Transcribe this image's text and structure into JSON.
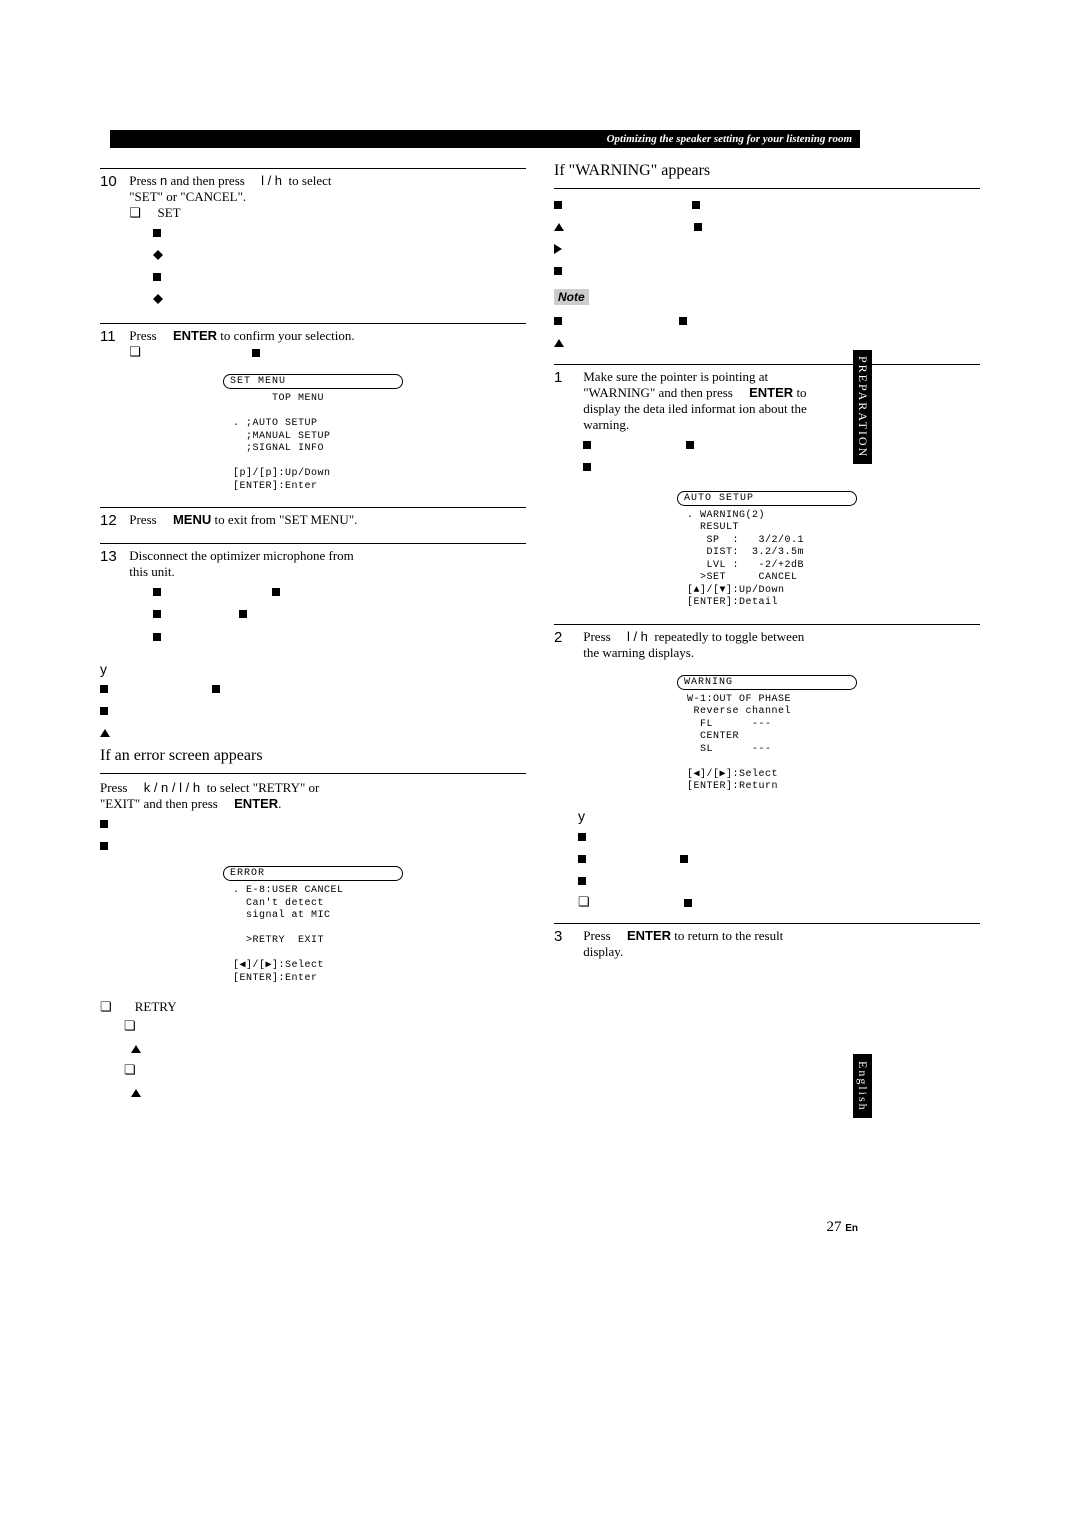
{
  "header": {
    "banner": "Optimizing the speaker setting for your listening room"
  },
  "side_tabs": {
    "prep": "PREPARATION",
    "lang": "English"
  },
  "left": {
    "step10": {
      "num": "10",
      "l1a": "Press",
      "l1b": "n",
      "l1c": "and then press",
      "l1d": "l / h",
      "l1e": "to select",
      "l2": "\"SET\" or \"CANCEL\".",
      "set": "SET"
    },
    "step11": {
      "num": "11",
      "l1a": "Press",
      "l1b": "ENTER",
      "l1c": "to confirm your selection."
    },
    "screen1": {
      "title": "SET MENU",
      "body": "      TOP MENU\n\n. ;AUTO SETUP\n  ;MANUAL SETUP\n  ;SIGNAL INFO\n\n[p]/[p]:Up/Down\n[ENTER]:Enter"
    },
    "step12": {
      "num": "12",
      "l1a": "Press",
      "l1b": "MENU",
      "l1c": "to exit from \"SET MENU\"."
    },
    "step13": {
      "num": "13",
      "l1": "Disconnect the optimizer microphone from",
      "l2": "this unit."
    },
    "y": "y",
    "error_heading": "If an error screen appears",
    "error_l1a": "Press",
    "error_l1b": "k / n / l / h",
    "error_l1c": "to select \"RETRY\" or",
    "error_l2a": "\"EXIT\" and then press",
    "error_l2b": "ENTER",
    "error_l2c": ".",
    "screen2": {
      "title": "ERROR",
      "body": ". E-8:USER CANCEL\n  Can't detect\n  signal at MIC\n\n  >RETRY  EXIT\n\n[◀]/[▶]:Select\n[ENTER]:Enter"
    },
    "retry": "RETRY"
  },
  "right": {
    "warn_heading": "If \"WARNING\" appears",
    "note_label": "Note",
    "step1": {
      "num": "1",
      "l1": "Make sure the pointer is pointing at",
      "l2a": "\"WARNING\" and then press",
      "l2b": "ENTER",
      "l2c": "to",
      "l3": "display the deta     iled informat   ion about the",
      "l4": "warning."
    },
    "screen3": {
      "title": "AUTO SETUP",
      "body": ". WARNING(2)\n  RESULT\n   SP  :   3/2/0.1\n   DIST:  3.2/3.5m\n   LVL :   -2/+2dB\n  >SET     CANCEL\n[▲]/[▼]:Up/Down\n[ENTER]:Detail"
    },
    "step2": {
      "num": "2",
      "l1a": "Press",
      "l1b": "l / h",
      "l1c": "repeatedly to toggle between",
      "l2": "the warning displays."
    },
    "screen4": {
      "title": "WARNING",
      "body": "W-1:OUT OF PHASE\n Reverse channel\n  FL      ---\n  CENTER\n  SL      ---\n\n[◀]/[▶]:Select\n[ENTER]:Return"
    },
    "y": "y",
    "step3": {
      "num": "3",
      "l1a": "Press",
      "l1b": "ENTER",
      "l1c": "to return to the result",
      "l2": "display."
    }
  },
  "footer": {
    "page": "27",
    "en": "En"
  }
}
